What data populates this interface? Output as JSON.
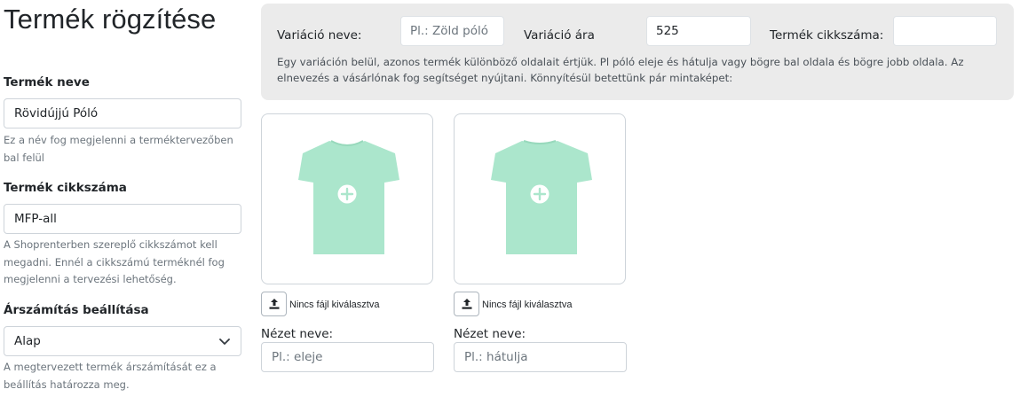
{
  "page_title": "Termék rögzítése",
  "product_name": {
    "label": "Termék neve",
    "value": "Rövidújjú Póló",
    "help": "Ez a név fog megjelenni a terméktervezőben bal felül"
  },
  "product_sku": {
    "label": "Termék cikkszáma",
    "value": "MFP-all",
    "help": "A Shoprenterben szereplő cikkszámot kell megadni. Ennél a cikkszámú terméknél fog megjelenni a tervezési lehetőség."
  },
  "pricing": {
    "label": "Árszámítás beállítása",
    "selected": "Alap",
    "help": "A megtervezett termék árszámítását ez a beállítás határozza meg."
  },
  "variation": {
    "name_label": "Variáció neve:",
    "name_placeholder": "Pl.: Zöld póló",
    "price_label": "Variáció ára",
    "price_value": "525",
    "sku_label": "Termék cikkszáma:",
    "sku_value": "",
    "description": "Egy variáción belül, azonos termék különböző oldalait értjük. Pl póló eleje és hátulja vagy bögre bal oldala és bögre jobb oldala. Az elnevezés a vásárlónak fog segítséget nyújtani. Könnyítésül betettünk pár mintaképet:"
  },
  "views": [
    {
      "image_icon": "tshirt-front-icon",
      "file_status": "Nincs fájl kiválasztva",
      "name_label": "Nézet neve:",
      "name_placeholder": "Pl.: eleje"
    },
    {
      "image_icon": "tshirt-back-icon",
      "file_status": "Nincs fájl kiválasztva",
      "name_label": "Nézet neve:",
      "name_placeholder": "Pl.: hátulja"
    }
  ],
  "colors": {
    "tshirt": "#abe6cc",
    "panel_bg": "#ebebeb",
    "muted_text": "#6c757d"
  }
}
